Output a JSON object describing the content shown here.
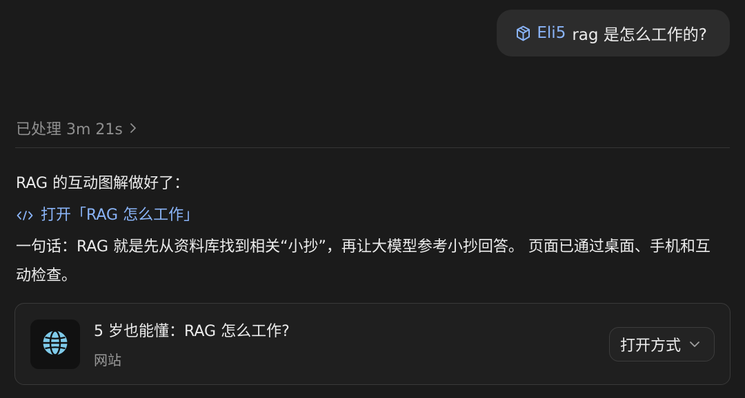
{
  "user_message": {
    "skill_chip": {
      "label": "Eli5",
      "icon": "cube-icon"
    },
    "text": "rag 是怎么工作的?"
  },
  "processing": {
    "label": "已处理 3m 21s",
    "icon": "chevron-right-icon"
  },
  "answer": {
    "intro": "RAG 的互动图解做好了：",
    "open_link": {
      "label": "打开「RAG 怎么工作」",
      "icon": "code-icon"
    },
    "summary": "一句话：RAG 就是先从资料库找到相关“小抄”，再让大模型参考小抄回答。 页面已通过桌面、手机和互动检查。"
  },
  "artifact_card": {
    "title": "5 岁也能懂：RAG 怎么工作?",
    "subtitle": "网站",
    "icon": "globe-icon",
    "open_with_label": "打开方式",
    "open_with_icon": "chevron-down-icon"
  },
  "colors": {
    "background": "#1b1b1b",
    "bubble": "#2c2c2c",
    "accent": "#8ab4f8",
    "globe": "#7fcbea"
  }
}
